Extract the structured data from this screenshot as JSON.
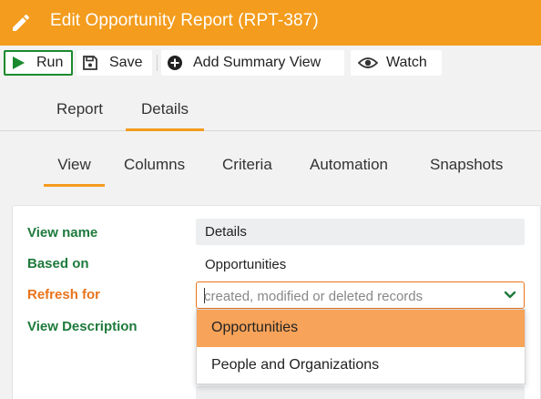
{
  "window": {
    "title": "Edit Opportunity Report (RPT-387)"
  },
  "toolbar": {
    "run_label": "Run",
    "save_label": "Save",
    "add_summary_label": "Add Summary View",
    "watch_label": "Watch"
  },
  "tabs_primary": [
    {
      "label": "Report",
      "active": false
    },
    {
      "label": "Details",
      "active": true
    }
  ],
  "tabs_secondary": [
    {
      "label": "View",
      "active": true
    },
    {
      "label": "Columns",
      "active": false
    },
    {
      "label": "Criteria",
      "active": false
    },
    {
      "label": "Automation",
      "active": false
    },
    {
      "label": "Snapshots",
      "active": false
    }
  ],
  "form": {
    "view_name_label": "View name",
    "view_name_value": "Details",
    "based_on_label": "Based on",
    "based_on_value": "Opportunities",
    "refresh_for_label": "Refresh for",
    "refresh_for_placeholder": "created, modified or deleted records",
    "view_description_label": "View Description"
  },
  "dropdown": {
    "options": [
      {
        "label": "Opportunities",
        "selected": true
      },
      {
        "label": "People and Organizations",
        "selected": false
      }
    ]
  },
  "colors": {
    "header_orange": "#f39c1d",
    "label_green": "#1e7a3c",
    "required_orange": "#e8741c",
    "dropdown_highlight": "#f7a359",
    "run_green": "#1b8a2e"
  },
  "icons": {
    "title": "pencil-icon",
    "run": "play-icon",
    "save": "floppy-disk-icon",
    "add_summary": "plus-circle-icon",
    "watch": "eye-icon",
    "select": "chevron-down-icon"
  }
}
